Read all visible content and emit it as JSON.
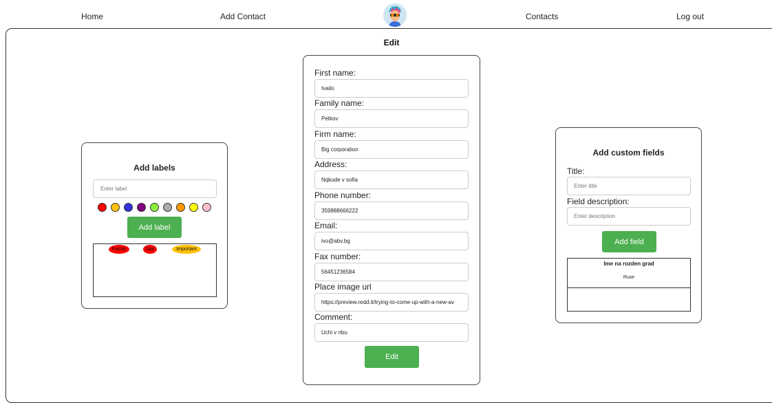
{
  "nav": {
    "home": "Home",
    "add_contact": "Add Contact",
    "contacts": "Contacts",
    "logout": "Log out"
  },
  "page_title": "Edit",
  "labels_panel": {
    "title": "Add labels",
    "input_placeholder": "Enter label",
    "colors": [
      "#ff0000",
      "#ffc107",
      "#3333dd",
      "#800080",
      "#90ee40",
      "#aaaaaa",
      "#ff9800",
      "#ffff00",
      "#ffc0cb"
    ],
    "add_button": "Add label",
    "labels": [
      {
        "text": "Family",
        "color": "#ff0000"
      },
      {
        "text": "Dad",
        "color": "#ff0000"
      },
      {
        "text": "Important",
        "color": "#ffc107"
      }
    ]
  },
  "form": {
    "fields": [
      {
        "label": "First name:",
        "value": "Ivailo"
      },
      {
        "label": "Family name:",
        "value": "Petkov"
      },
      {
        "label": "Firm name:",
        "value": "Big corporation"
      },
      {
        "label": "Address:",
        "value": "Nqkude v sofia"
      },
      {
        "label": "Phone number:",
        "value": "359888666222"
      },
      {
        "label": "Email:",
        "value": "ivo@abv.bg"
      },
      {
        "label": "Fax number:",
        "value": "56451236584"
      },
      {
        "label": "Place image url",
        "value": "https://preview.redd.it/trying-to-come-up-with-a-new-av"
      },
      {
        "label": "Comment:",
        "value": "Uchi v nbu"
      }
    ],
    "submit": "Edit"
  },
  "custom_panel": {
    "title": "Add custom fields",
    "title_label": "Title:",
    "title_placeholder": "Enter title",
    "desc_label": "Field description:",
    "desc_placeholder": "Enter description",
    "add_button": "Add field",
    "entries": [
      {
        "title": "Ime na rozden grad",
        "description": "Ruse"
      }
    ]
  }
}
